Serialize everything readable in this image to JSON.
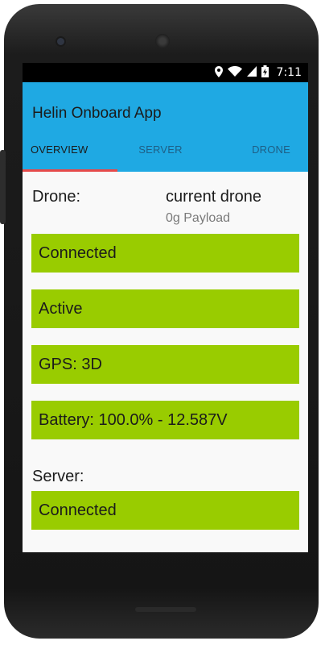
{
  "statusbar": {
    "icons": [
      "location-icon",
      "wifi-icon",
      "signal-icon",
      "battery-charging-icon"
    ],
    "time": "7:11"
  },
  "app": {
    "title": "Helin Onboard App",
    "tabs": [
      {
        "label": "OVERVIEW",
        "active": true
      },
      {
        "label": "SERVER",
        "active": false
      },
      {
        "label": "DRONE",
        "active": false
      }
    ]
  },
  "drone": {
    "label": "Drone:",
    "name": "current drone",
    "payload": "0g Payload",
    "statuses": [
      {
        "text": "Connected"
      },
      {
        "text": "Active"
      },
      {
        "text": "GPS: 3D"
      },
      {
        "text": "Battery: 100.0% - 12.587V"
      }
    ]
  },
  "server": {
    "label": "Server:",
    "status": "Connected"
  },
  "colors": {
    "actionbar": "#1fa9e3",
    "status_ok": "#99cc00",
    "tab_indicator": "#e64a4a"
  }
}
